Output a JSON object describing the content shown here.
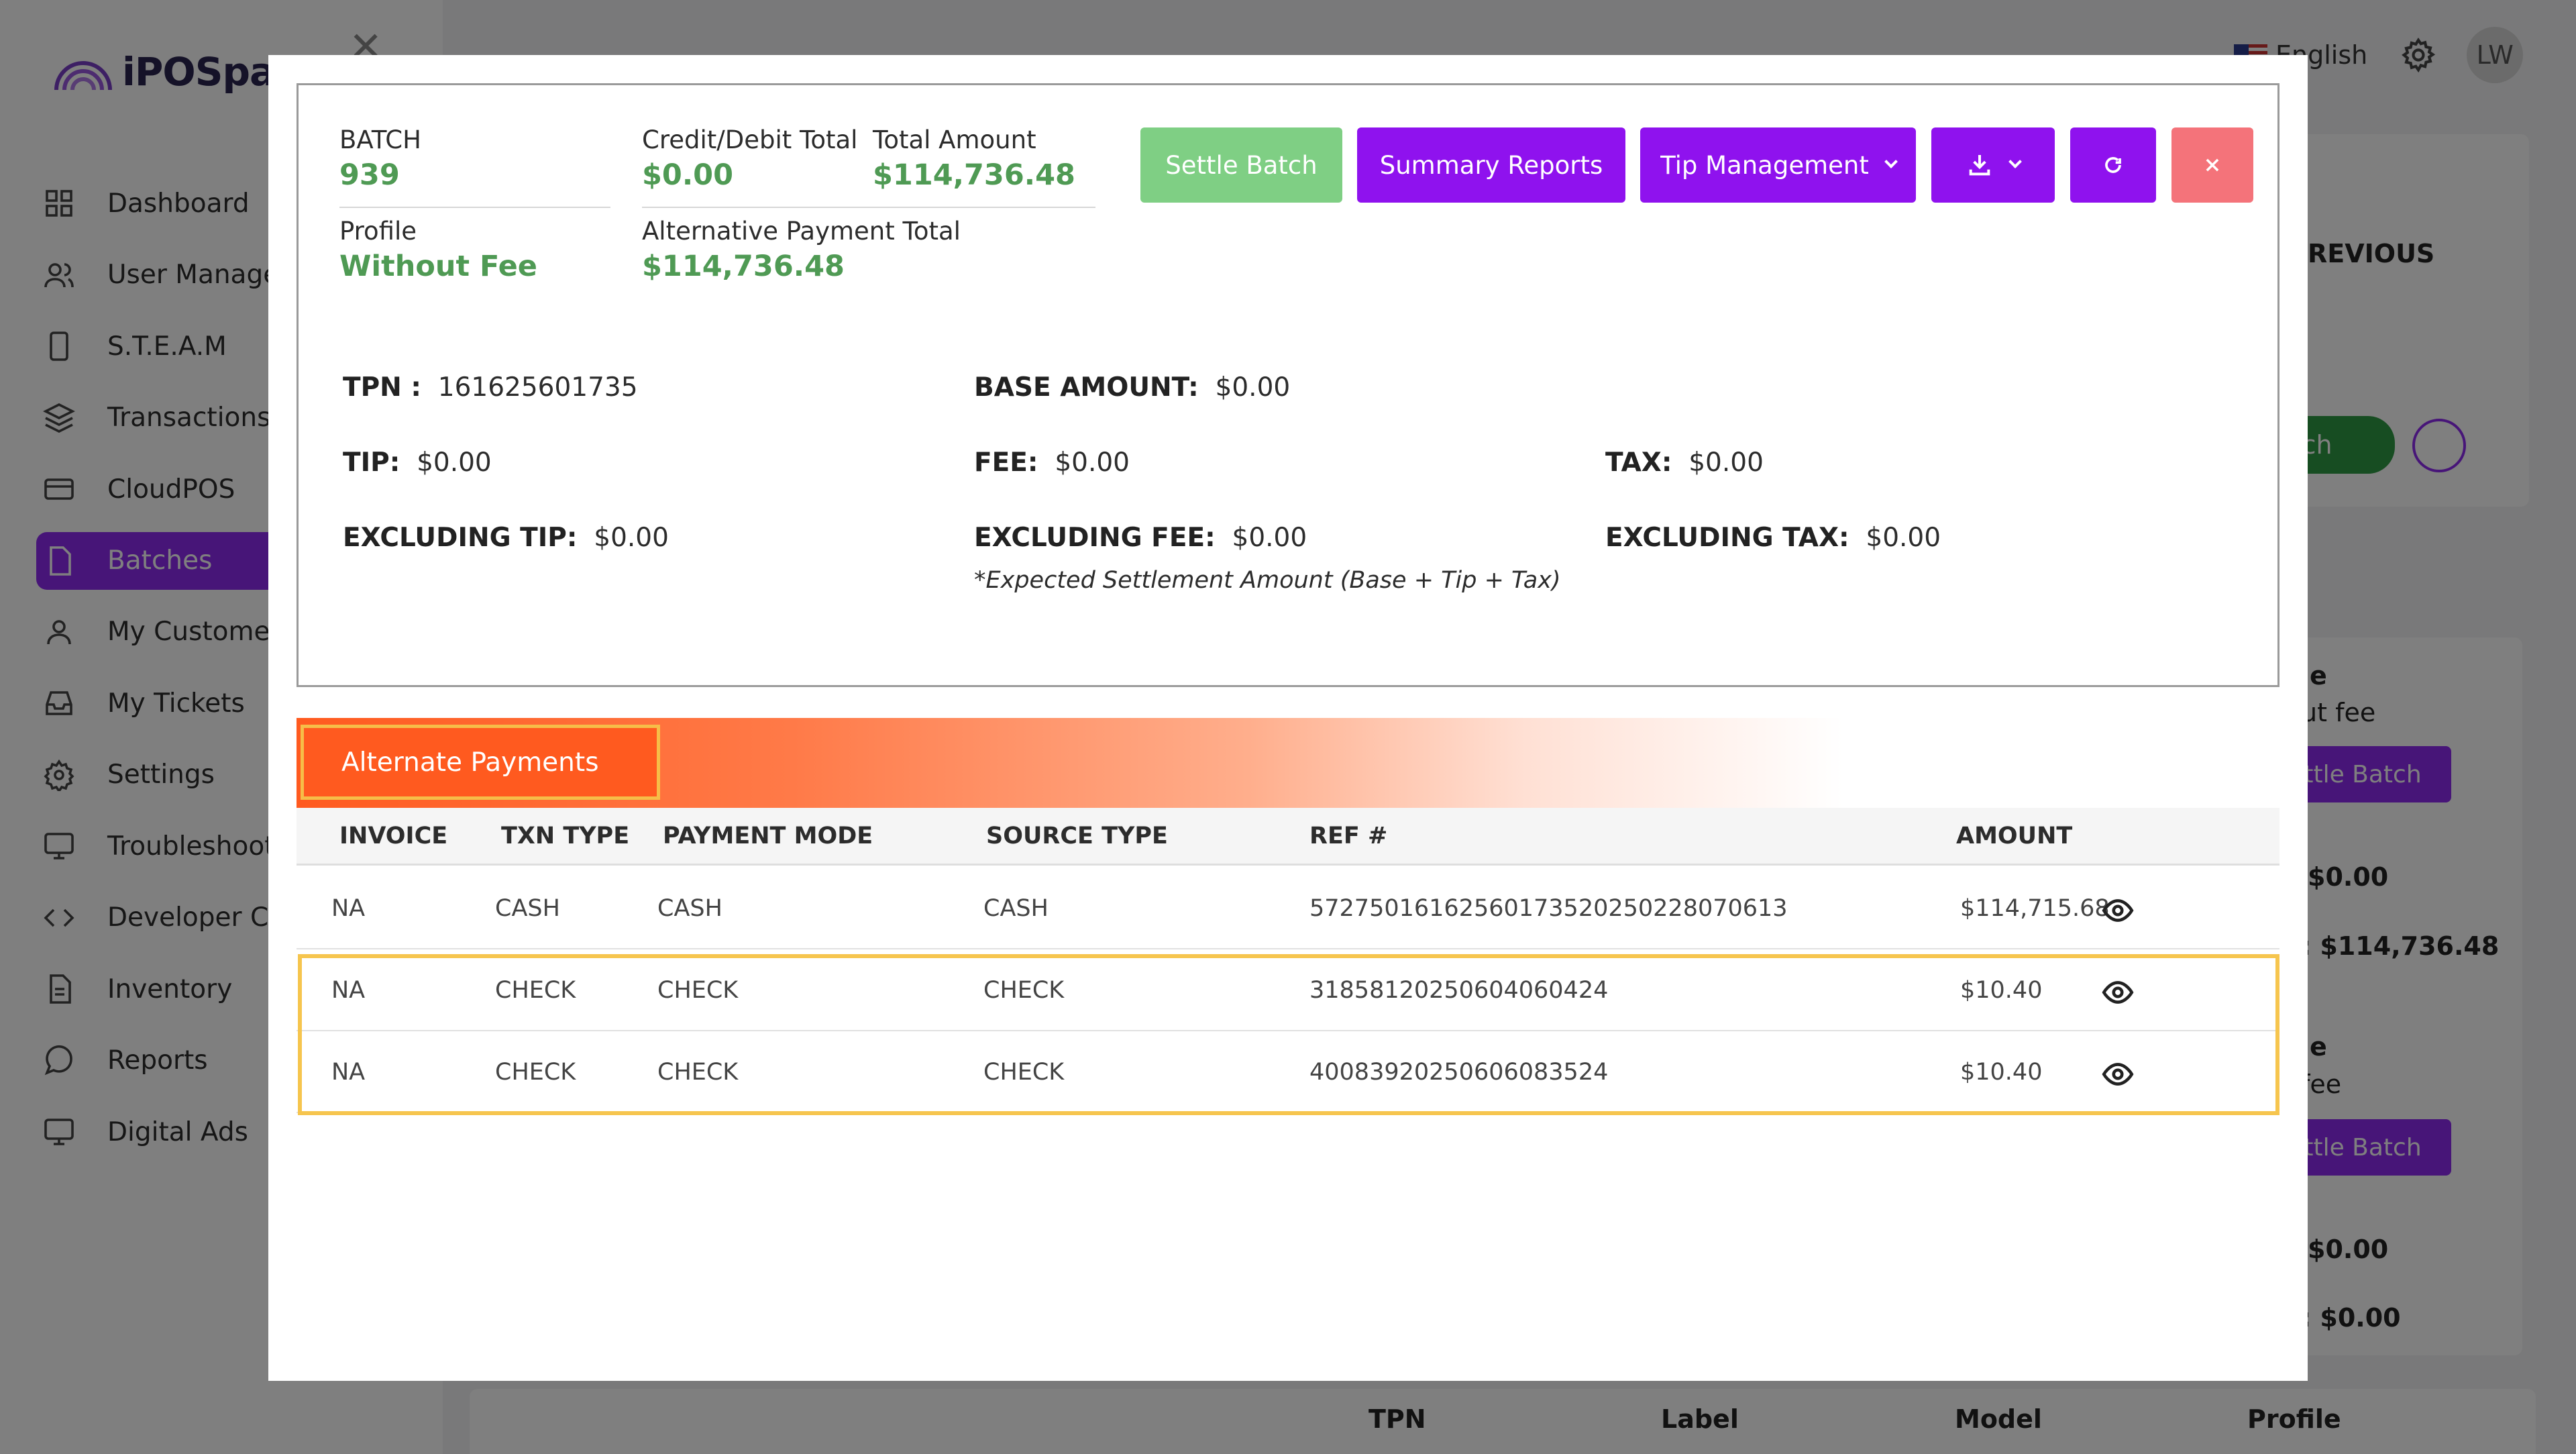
{
  "app": {
    "logo_text": "iPOSpay",
    "language": "English",
    "avatar_initials": "LW"
  },
  "sidebar": {
    "items": [
      {
        "label": "Dashboard",
        "icon": "grid-icon"
      },
      {
        "label": "User Managem",
        "icon": "users-icon"
      },
      {
        "label": "S.T.E.A.M",
        "icon": "phone-icon"
      },
      {
        "label": "Transactions",
        "icon": "layers-icon"
      },
      {
        "label": "CloudPOS",
        "icon": "card-icon"
      },
      {
        "label": "Batches",
        "icon": "file-icon",
        "active": true
      },
      {
        "label": "My Customers",
        "icon": "person-icon"
      },
      {
        "label": "My Tickets",
        "icon": "inbox-icon"
      },
      {
        "label": "Settings",
        "icon": "gear-icon"
      },
      {
        "label": "Troubleshootin",
        "icon": "monitor-icon"
      },
      {
        "label": "Developer Cen",
        "icon": "code-icon"
      },
      {
        "label": "Inventory",
        "icon": "document-icon"
      },
      {
        "label": "Reports",
        "icon": "chat-icon"
      },
      {
        "label": "Digital Ads",
        "icon": "screen-icon"
      }
    ]
  },
  "background": {
    "previous_label": "REVIOUS",
    "batch_btn": "atch",
    "card1": {
      "title": "le",
      "subtitle": "ut fee",
      "btn": "ttle Batch",
      "v1": "$0.00",
      "v2": ": $114,736.48"
    },
    "card2": {
      "title": "le",
      "subtitle": "fee",
      "btn": "ttle Batch",
      "v1": "$0.00",
      "v2": ": $0.00"
    },
    "footer": {
      "c1": "TPN",
      "c2": "Label",
      "c3": "Model",
      "c4": "Profile"
    }
  },
  "summary": {
    "batch_label": "BATCH",
    "batch_value": "939",
    "credit_label": "Credit/Debit Total",
    "credit_value": "$0.00",
    "total_label": "Total Amount",
    "total_value": "$114,736.48",
    "profile_label": "Profile",
    "profile_value": "Without Fee",
    "alt_label": "Alternative Payment Total",
    "alt_value": "$114,736.48",
    "buttons": {
      "settle": "Settle Batch",
      "summary": "Summary Reports",
      "tip": "Tip Management"
    },
    "tpn_label": "TPN :",
    "tpn_value": "161625601735",
    "base_label": "BASE AMOUNT:",
    "base_value": "$0.00",
    "tip_label": "TIP:",
    "tip_value": "$0.00",
    "fee_label": "FEE:",
    "fee_value": "$0.00",
    "tax_label": "TAX:",
    "tax_value": "$0.00",
    "ex_tip_label": "EXCLUDING TIP:",
    "ex_tip_value": "$0.00",
    "ex_fee_label": "EXCLUDING FEE:",
    "ex_fee_value": "$0.00",
    "ex_tax_label": "EXCLUDING TAX:",
    "ex_tax_value": "$0.00",
    "note": "*Expected Settlement Amount (Base + Tip + Tax)"
  },
  "alt_payments": {
    "title": "Alternate Payments",
    "columns": [
      "INVOICE",
      "TXN TYPE",
      "PAYMENT MODE",
      "SOURCE TYPE",
      "REF #",
      "AMOUNT"
    ],
    "rows": [
      {
        "invoice": "NA",
        "txn_type": "CASH",
        "payment_mode": "CASH",
        "source_type": "CASH",
        "ref": "5727501616256017352025022807061​3",
        "amount": "$114,715.68"
      },
      {
        "invoice": "NA",
        "txn_type": "CHECK",
        "payment_mode": "CHECK",
        "source_type": "CHECK",
        "ref": "31858120250604060424",
        "amount": "$10.40"
      },
      {
        "invoice": "NA",
        "txn_type": "CHECK",
        "payment_mode": "CHECK",
        "source_type": "CHECK",
        "ref": "40083920250606083524",
        "amount": "$10.40"
      }
    ]
  }
}
